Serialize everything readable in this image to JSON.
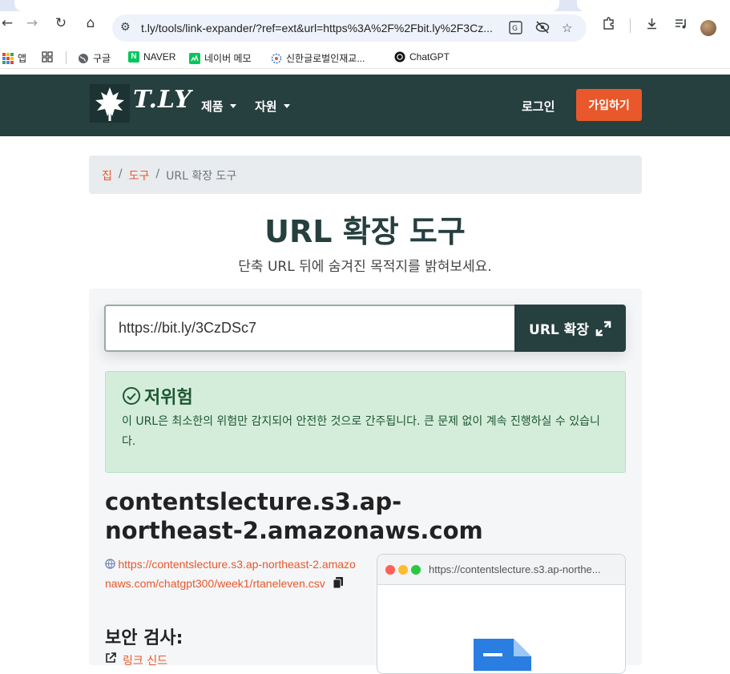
{
  "browser": {
    "url": "t.ly/tools/link-expander/?ref=ext&url=https%3A%2F%2Fbit.ly%2F3Cz...",
    "bookmarks": [
      {
        "label": "앱",
        "icon": "apps-grid-icon"
      },
      {
        "label": "",
        "icon": "tab-groups-icon"
      },
      {
        "label": "구글",
        "icon": "globe-icon"
      },
      {
        "label": "NAVER",
        "icon": "naver-icon"
      },
      {
        "label": "네이버 메모",
        "icon": "memo-icon"
      },
      {
        "label": "신한글로벌인재교...",
        "icon": "shinhan-icon"
      },
      {
        "label": "ChatGPT",
        "icon": "chatgpt-icon"
      }
    ]
  },
  "nav": {
    "brand": "T.LY",
    "products": "제품",
    "resources": "자원",
    "login": "로그인",
    "signup": "가입하기"
  },
  "breadcrumb": {
    "home": "집",
    "tools": "도구",
    "sep": "/",
    "current": "URL 확장 도구"
  },
  "page": {
    "title": "URL 확장 도구",
    "subtitle": "단축 URL 뒤에 숨겨진 목적지를 밝혀보세요."
  },
  "expander": {
    "input_value": "https://bit.ly/3CzDSc7",
    "button_label": "URL 확장"
  },
  "result": {
    "risk_title": "저위험",
    "risk_text": "이 URL은 최소한의 위험만 감지되어 안전한 것으로 간주됩니다. 큰 문제 없이 계속 진행하실 수 있습니다.",
    "domain": "contentslecture.s3.ap-northeast-2.amazonaws.com",
    "destination": "https://contentslecture.s3.ap-northeast-2.amazonaws.com/chatgpt300/week1/rtaneleven.csv",
    "security_title": "보안 검사:",
    "link_partial": "링크 신드",
    "preview_url": "https://contentslecture.s3.ap-northe..."
  },
  "colors": {
    "nav_bg": "#263f3f",
    "accent": "#e8582a",
    "success_bg": "#d4edda",
    "success_text": "#1e5631"
  }
}
